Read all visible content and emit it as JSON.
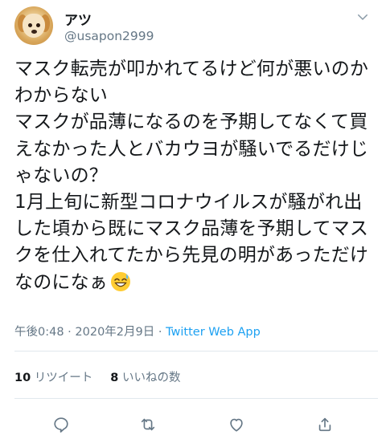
{
  "user": {
    "display_name": "アツ",
    "handle": "@usapon2999"
  },
  "tweet": {
    "text": "マスク転売が叩かれてるけど何が悪いのかわからない\nマスクが品薄になるのを予期してなくて買えなかった人とバカウヨが騒いでるだけじゃないの？\n1月上旬に新型コロナウイルスが騒がれ出した頃から既にマスク品薄を予期してマスクを仕入れてたから先見の明があっただけなのになぁ",
    "emoji": "sweat-smile-emoji"
  },
  "meta": {
    "timestamp": "午後0:48 · 2020年2月9日 · ",
    "source": "Twitter Web App"
  },
  "stats": {
    "retweets_count": "10",
    "retweets_label": "リツイート",
    "likes_count": "8",
    "likes_label": "いいねの数"
  },
  "icons": [
    "avatar",
    "chevron-down-icon",
    "reply-icon",
    "retweet-icon",
    "like-icon",
    "share-icon"
  ],
  "colors": {
    "text": "#14171a",
    "secondary": "#657786",
    "link": "#1da1f2",
    "divider": "#e1e8ed"
  }
}
